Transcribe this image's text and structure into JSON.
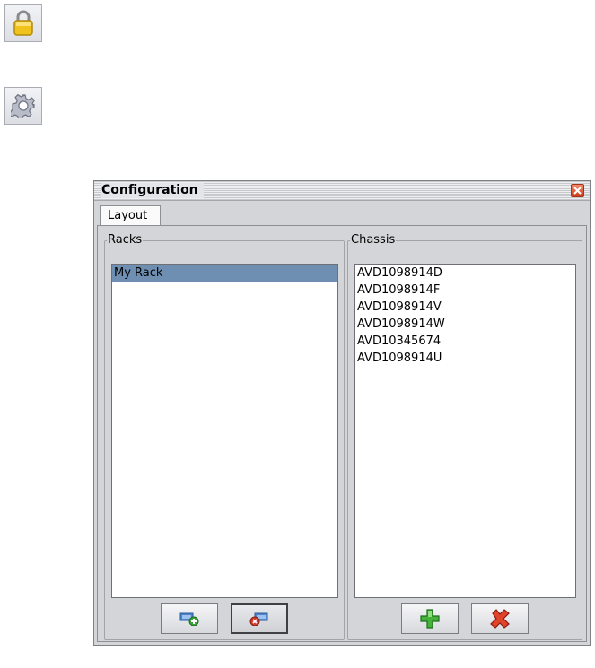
{
  "toolbar": {
    "lock_icon": "lock-icon",
    "gear_icon": "gear-icon"
  },
  "dialog": {
    "title": "Configuration",
    "close_icon": "close-icon",
    "tabs": [
      {
        "label": "Layout"
      }
    ],
    "racks": {
      "legend": "Racks",
      "items": [
        "My Rack"
      ],
      "selected_index": 0,
      "buttons": [
        {
          "icon": "add-rack-icon"
        },
        {
          "icon": "remove-rack-icon"
        }
      ]
    },
    "chassis": {
      "legend": "Chassis",
      "items": [
        "AVD1098914D",
        "AVD1098914F",
        "AVD1098914V",
        "AVD1098914W",
        "AVD10345674",
        "AVD1098914U"
      ],
      "buttons": [
        {
          "icon": "add-icon"
        },
        {
          "icon": "delete-icon"
        }
      ]
    }
  }
}
